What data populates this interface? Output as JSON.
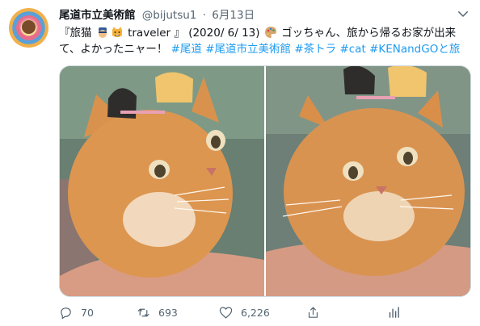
{
  "tweet": {
    "author_name": "尾道市立美術館",
    "handle": "@bijutsu1",
    "separator": "·",
    "date": "6月13日",
    "text_parts": {
      "open": "『旅猫",
      "word": "traveler 』 (2020/ 6/ 13)",
      "line1_after_palette": "ゴッちゃん、旅から帰るお家が出来",
      "line2_start": "て、よかったニャー！",
      "hashtags": [
        "#尾道",
        "#尾道市立美術館",
        "#茶トラ",
        "#cat",
        "#KENandGOと旅"
      ]
    },
    "icons": {
      "emoji1": "police-officer-emoji",
      "emoji2": "grinning-cat-emoji",
      "emoji3": "artist-palette-emoji"
    },
    "colors": {
      "link": "#1d9bf0",
      "muted": "#536471",
      "border": "#cfd9de"
    },
    "counts": {
      "replies": "70",
      "retweets": "693",
      "likes": "6,226"
    }
  }
}
